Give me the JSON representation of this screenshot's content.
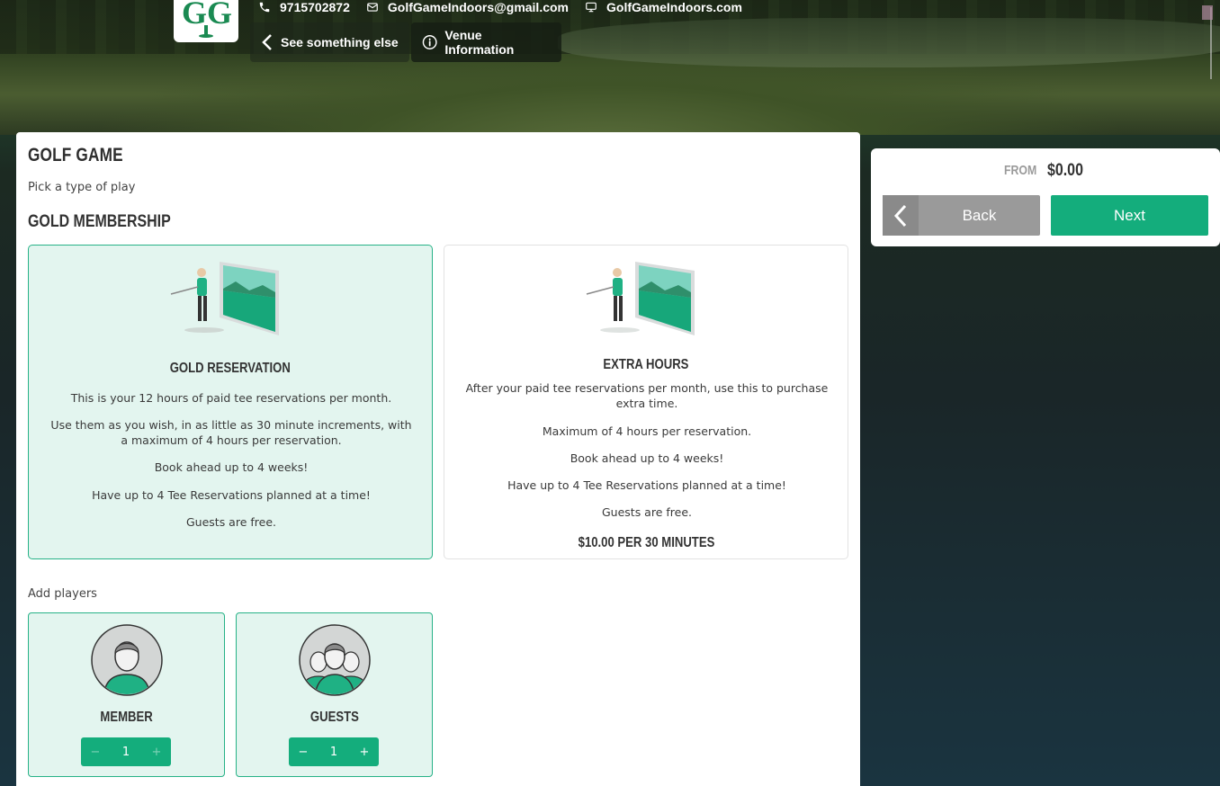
{
  "header": {
    "phone": "9715702872",
    "email": "GolfGameIndoors@gmail.com",
    "website": "GolfGameIndoors.com",
    "back_label": "See something else",
    "info_label": "Venue Information",
    "logo_text": "GG"
  },
  "main": {
    "title": "GOLF GAME",
    "subtitle": "Pick a type of play",
    "section": "GOLD MEMBERSHIP",
    "options": [
      {
        "title": "GOLD RESERVATION",
        "selected": true,
        "lines": [
          "This is your 12 hours of paid tee reservations per month.",
          "Use them as you wish, in as little as 30 minute increments, with a maximum of 4 hours per reservation.",
          "Book ahead up to 4 weeks!",
          "Have up to 4 Tee Reservations planned at a time!",
          "Guests are free."
        ]
      },
      {
        "title": "EXTRA HOURS",
        "selected": false,
        "lines": [
          "After your paid tee reservations per month, use this to purchase extra time.",
          "Maximum of 4 hours per reservation.",
          "Book ahead up to 4 weeks!",
          "Have up to 4 Tee Reservations planned at a time!",
          "Guests are free."
        ],
        "price": "$10.00 PER 30 MINUTES"
      }
    ],
    "add_players_label": "Add players",
    "players": [
      {
        "label": "MEMBER",
        "count": "1",
        "minus": "−",
        "plus": "+"
      },
      {
        "label": "GUESTS",
        "count": "1",
        "minus": "−",
        "plus": "+"
      }
    ]
  },
  "summary": {
    "from_label": "FROM",
    "amount": "$0.00",
    "back_label": "Back",
    "next_label": "Next"
  },
  "colors": {
    "accent": "#14ad7c",
    "selected_bg": "#e3f5ef",
    "back_btn": "#9a9a9a"
  }
}
